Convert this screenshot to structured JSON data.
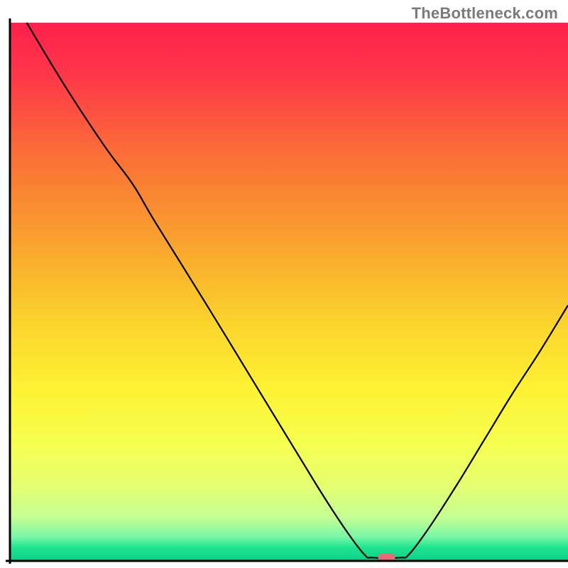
{
  "brand": "TheBottleneck.com",
  "chart_data": {
    "type": "line",
    "title": "",
    "xlabel": "",
    "ylabel": "",
    "x_range": [
      0,
      100
    ],
    "y_range": [
      0,
      100
    ],
    "marker": {
      "x": 67.5,
      "y": 0.6,
      "color": "#ed6a74"
    },
    "curve": [
      {
        "x": 3.0,
        "y": 100.0
      },
      {
        "x": 10.0,
        "y": 88.0
      },
      {
        "x": 17.0,
        "y": 77.0
      },
      {
        "x": 22.0,
        "y": 70.0
      },
      {
        "x": 26.0,
        "y": 63.0
      },
      {
        "x": 35.0,
        "y": 48.0
      },
      {
        "x": 45.0,
        "y": 31.0
      },
      {
        "x": 55.0,
        "y": 14.0
      },
      {
        "x": 60.0,
        "y": 6.0
      },
      {
        "x": 63.5,
        "y": 1.2
      },
      {
        "x": 65.0,
        "y": 0.6
      },
      {
        "x": 70.0,
        "y": 0.6
      },
      {
        "x": 71.5,
        "y": 1.2
      },
      {
        "x": 75.0,
        "y": 6.0
      },
      {
        "x": 80.0,
        "y": 14.0
      },
      {
        "x": 85.0,
        "y": 22.5
      },
      {
        "x": 90.0,
        "y": 31.0
      },
      {
        "x": 95.0,
        "y": 39.0
      },
      {
        "x": 100.0,
        "y": 47.5
      }
    ],
    "gradient_stops": [
      {
        "offset": 0.0,
        "color": "#ff1f4b"
      },
      {
        "offset": 0.1,
        "color": "#ff3848"
      },
      {
        "offset": 0.25,
        "color": "#fb7037"
      },
      {
        "offset": 0.4,
        "color": "#f9a02e"
      },
      {
        "offset": 0.55,
        "color": "#fbd22b"
      },
      {
        "offset": 0.68,
        "color": "#fef233"
      },
      {
        "offset": 0.78,
        "color": "#f6ff4e"
      },
      {
        "offset": 0.86,
        "color": "#e6ff71"
      },
      {
        "offset": 0.92,
        "color": "#c3ff93"
      },
      {
        "offset": 0.955,
        "color": "#79f7a5"
      },
      {
        "offset": 0.975,
        "color": "#1ee58f"
      },
      {
        "offset": 1.0,
        "color": "#0fcf88"
      }
    ]
  }
}
